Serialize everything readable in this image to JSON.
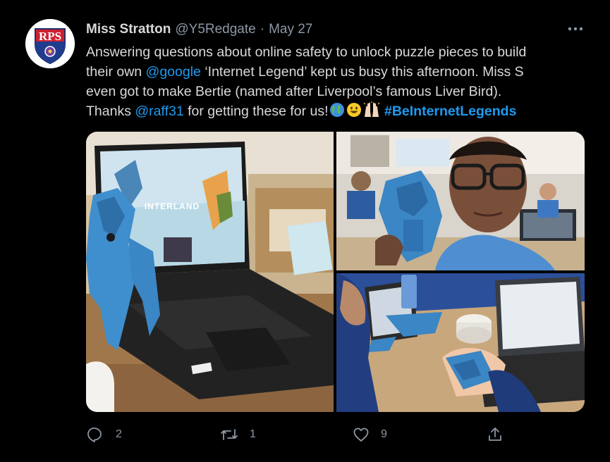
{
  "author": {
    "name": "Miss Stratton",
    "handle": "@Y5Redgate",
    "separator": "·",
    "date": "May 27",
    "avatar_text": "RPS"
  },
  "tweet": {
    "line1": "Answering questions about online safety to unlock puzzle pieces to build",
    "line2_before": "their own ",
    "line2_mention": "@google",
    "line2_after": " ‘Internet Legend’ kept us busy this afternoon. Miss S",
    "line3": "even got to make Bertie (named after Liverpool’s famous Liver Bird).",
    "line4_before": "Thanks ",
    "line4_mention": "@raff31",
    "line4_after": " for getting these for us!",
    "emojis": [
      "globe-emoji",
      "smiley-emoji",
      "raised-hands-emoji"
    ],
    "hashtag": "#BeInternetLegends"
  },
  "photos": {
    "laptop_screen_title": "INTERLAND"
  },
  "actions": {
    "replies": "2",
    "retweets": "1",
    "likes": "9"
  },
  "colors": {
    "background": "#000000",
    "text": "#d9d9d9",
    "muted": "#8b98a5",
    "accent": "#1d9bf0"
  },
  "icons": {
    "more": "more-dots-icon",
    "reply": "reply-icon",
    "retweet": "retweet-icon",
    "like": "like-icon",
    "share": "share-icon"
  }
}
